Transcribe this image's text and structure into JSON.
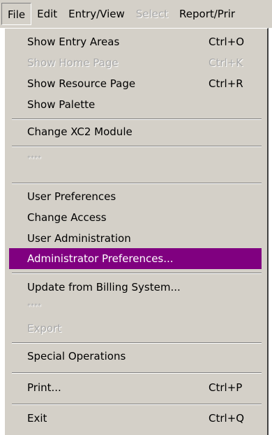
{
  "menubar": {
    "items": [
      {
        "label": "File"
      },
      {
        "label": "Edit"
      },
      {
        "label": "Entry/View"
      },
      {
        "label": "Select"
      },
      {
        "label": "Report/Prir"
      }
    ]
  },
  "file_menu": {
    "show_entry_areas": {
      "label": "Show Entry Areas",
      "shortcut": "Ctrl+O"
    },
    "show_home_page": {
      "label": "Show Home Page",
      "shortcut": "Ctrl+K"
    },
    "show_resource_page": {
      "label": "Show Resource Page",
      "shortcut": "Ctrl+R"
    },
    "show_palette": {
      "label": "Show Palette"
    },
    "change_module": {
      "label": "Change XC2 Module"
    },
    "placeholder_1": {
      "label": "****"
    },
    "user_preferences": {
      "label": "User Preferences"
    },
    "change_access": {
      "label": "Change Access"
    },
    "user_administration": {
      "label": "User Administration"
    },
    "administrator_preferences": {
      "label": "Administrator Preferences..."
    },
    "update_billing": {
      "label": "Update from Billing System..."
    },
    "placeholder_2": {
      "label": "****"
    },
    "export": {
      "label": "Export"
    },
    "special_operations": {
      "label": "Special Operations"
    },
    "print": {
      "label": "Print...",
      "shortcut": "Ctrl+P"
    },
    "exit": {
      "label": "Exit",
      "shortcut": "Ctrl+Q"
    }
  },
  "colors": {
    "menu_background": "#d4d0c8",
    "highlight": "#800080",
    "disabled_text": "#a8a8a8"
  }
}
